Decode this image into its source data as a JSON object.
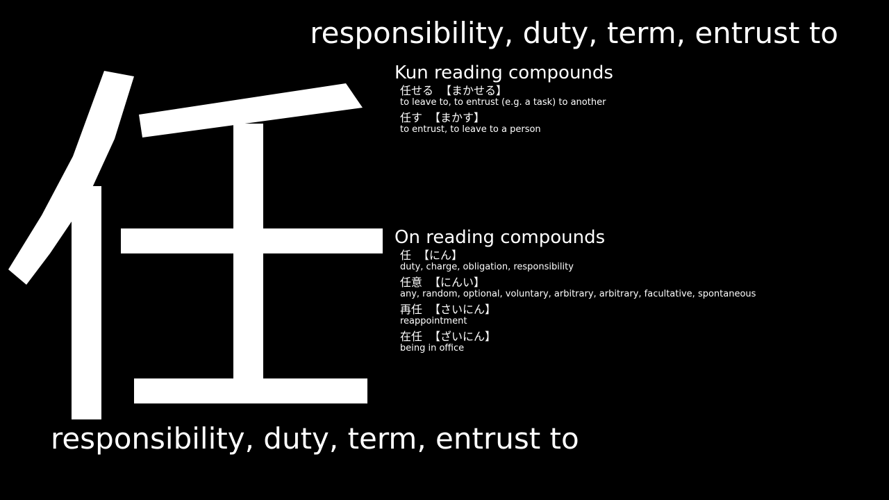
{
  "kanji": "任",
  "meaning": "responsibility, duty, term, entrust to",
  "kun_section": {
    "heading": "Kun reading compounds",
    "items": [
      {
        "word": "任せる",
        "reading": "【まかせる】",
        "definition": "to leave to, to entrust (e.g. a task) to another"
      },
      {
        "word": "任す",
        "reading": "【まかす】",
        "definition": "to entrust, to leave to a person"
      }
    ]
  },
  "on_section": {
    "heading": "On reading compounds",
    "items": [
      {
        "word": "任",
        "reading": "【にん】",
        "definition": "duty, charge, obligation, responsibility"
      },
      {
        "word": "任意",
        "reading": "【にんい】",
        "definition": "any, random, optional, voluntary, arbitrary, arbitrary, facultative, spontaneous"
      },
      {
        "word": "再任",
        "reading": "【さいにん】",
        "definition": "reappointment"
      },
      {
        "word": "在任",
        "reading": "【ざいにん】",
        "definition": "being in office"
      }
    ]
  }
}
